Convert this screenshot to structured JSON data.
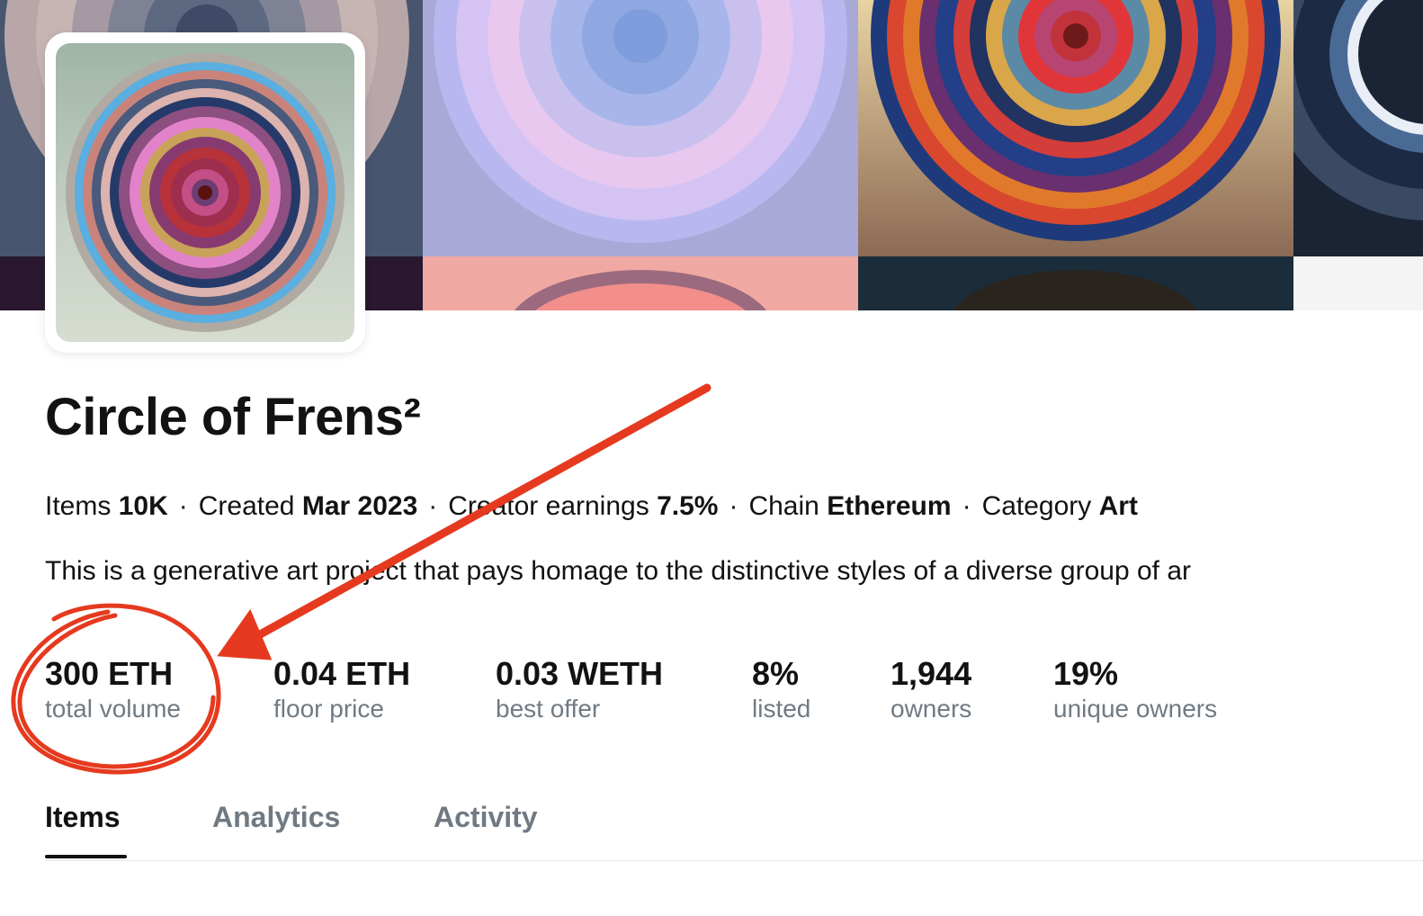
{
  "collection": {
    "title": "Circle of Frens²",
    "meta": [
      {
        "label": "Items",
        "value": "10K"
      },
      {
        "label": "Created",
        "value": "Mar 2023"
      },
      {
        "label": "Creator earnings",
        "value": "7.5%"
      },
      {
        "label": "Chain",
        "value": "Ethereum"
      },
      {
        "label": "Category",
        "value": "Art"
      }
    ],
    "separator": "·",
    "description": "This is a generative art project that pays homage to the distinctive styles of a diverse group of ar"
  },
  "stats": [
    {
      "value": "300 ETH",
      "label": "total volume"
    },
    {
      "value": "0.04 ETH",
      "label": "floor price"
    },
    {
      "value": "0.03 WETH",
      "label": "best offer"
    },
    {
      "value": "8%",
      "label": "listed"
    },
    {
      "value": "1,944",
      "label": "owners"
    },
    {
      "value": "19%",
      "label": "unique owners"
    }
  ],
  "tabs": [
    {
      "label": "Items",
      "active": true
    },
    {
      "label": "Analytics",
      "active": false
    },
    {
      "label": "Activity",
      "active": false
    }
  ],
  "colors": {
    "text": "#121212",
    "muted": "#707a83",
    "annotation": "#e53a1f"
  },
  "icons": {
    "annotation_circle": "hand-drawn-circle",
    "annotation_arrow": "hand-drawn-arrow"
  }
}
